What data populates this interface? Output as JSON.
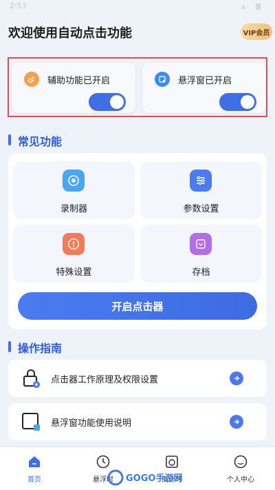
{
  "status_bar": {
    "time": "2:53"
  },
  "header": {
    "title": "欢迎使用自动点击功能",
    "vip_label": "VIP会员"
  },
  "status_cards": [
    {
      "label": "辅助功能已开启",
      "icon": "accessibility-icon",
      "enabled": true
    },
    {
      "label": "悬浮窗已开启",
      "icon": "floating-window-icon",
      "enabled": true
    }
  ],
  "common_features": {
    "title": "常见功能",
    "items": [
      {
        "label": "录制器",
        "icon": "record-icon"
      },
      {
        "label": "参数设置",
        "icon": "sliders-icon"
      },
      {
        "label": "特殊设置",
        "icon": "warning-icon"
      },
      {
        "label": "存档",
        "icon": "archive-icon"
      }
    ],
    "start_button": "开启点击器"
  },
  "guide": {
    "title": "操作指南",
    "items": [
      {
        "label": "点击器工作原理及权限设置",
        "icon": "lock-settings-icon"
      },
      {
        "label": "悬浮窗功能使用说明",
        "icon": "floating-window-guide-icon"
      }
    ]
  },
  "bottom_nav": [
    {
      "label": "首页",
      "icon": "home-icon",
      "active": true
    },
    {
      "label": "悬浮时",
      "icon": "clock-icon",
      "active": false
    },
    {
      "label": "倒计时",
      "icon": "timer-icon",
      "active": false
    },
    {
      "label": "个人中心",
      "icon": "profile-icon",
      "active": false
    }
  ],
  "watermark": {
    "text": "GOGO手游网"
  },
  "colors": {
    "accent": "#3e6fe4",
    "highlight_border": "#e84b4b",
    "vip_bg": "#f0c27c"
  }
}
